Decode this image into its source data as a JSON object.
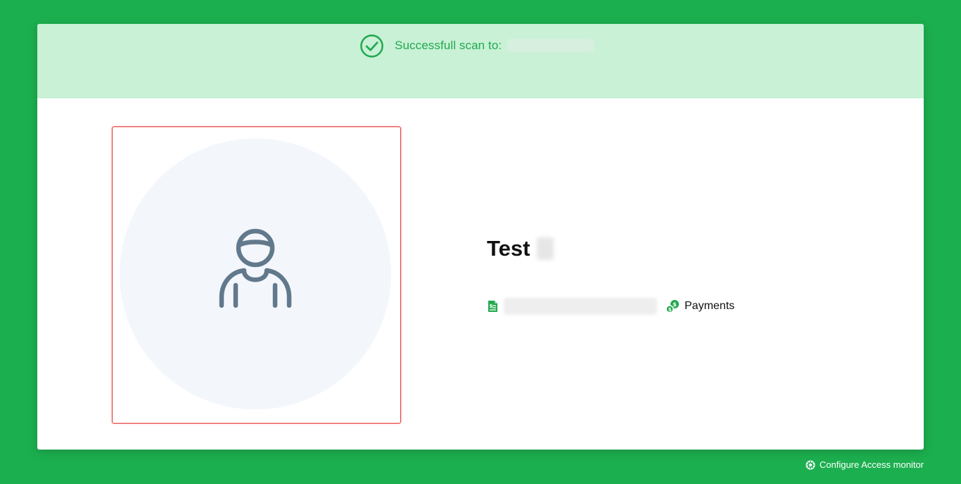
{
  "banner": {
    "scan_label": "Successfull scan to:",
    "scan_target": "",
    "color": "#22a94e",
    "background": "#c8f1d6"
  },
  "profile": {
    "name": "Test",
    "photo_placeholder_icon": "user-icon",
    "frame_color": "#e43434"
  },
  "info": {
    "document_icon": "document-icon",
    "document_text": "",
    "payments_icon": "money-icon",
    "payments_label": "Payments"
  },
  "footer": {
    "configure_icon": "gear-icon",
    "configure_label": "Configure Access monitor"
  },
  "colors": {
    "page_background": "#1caf4f",
    "accent": "#22a94e"
  }
}
